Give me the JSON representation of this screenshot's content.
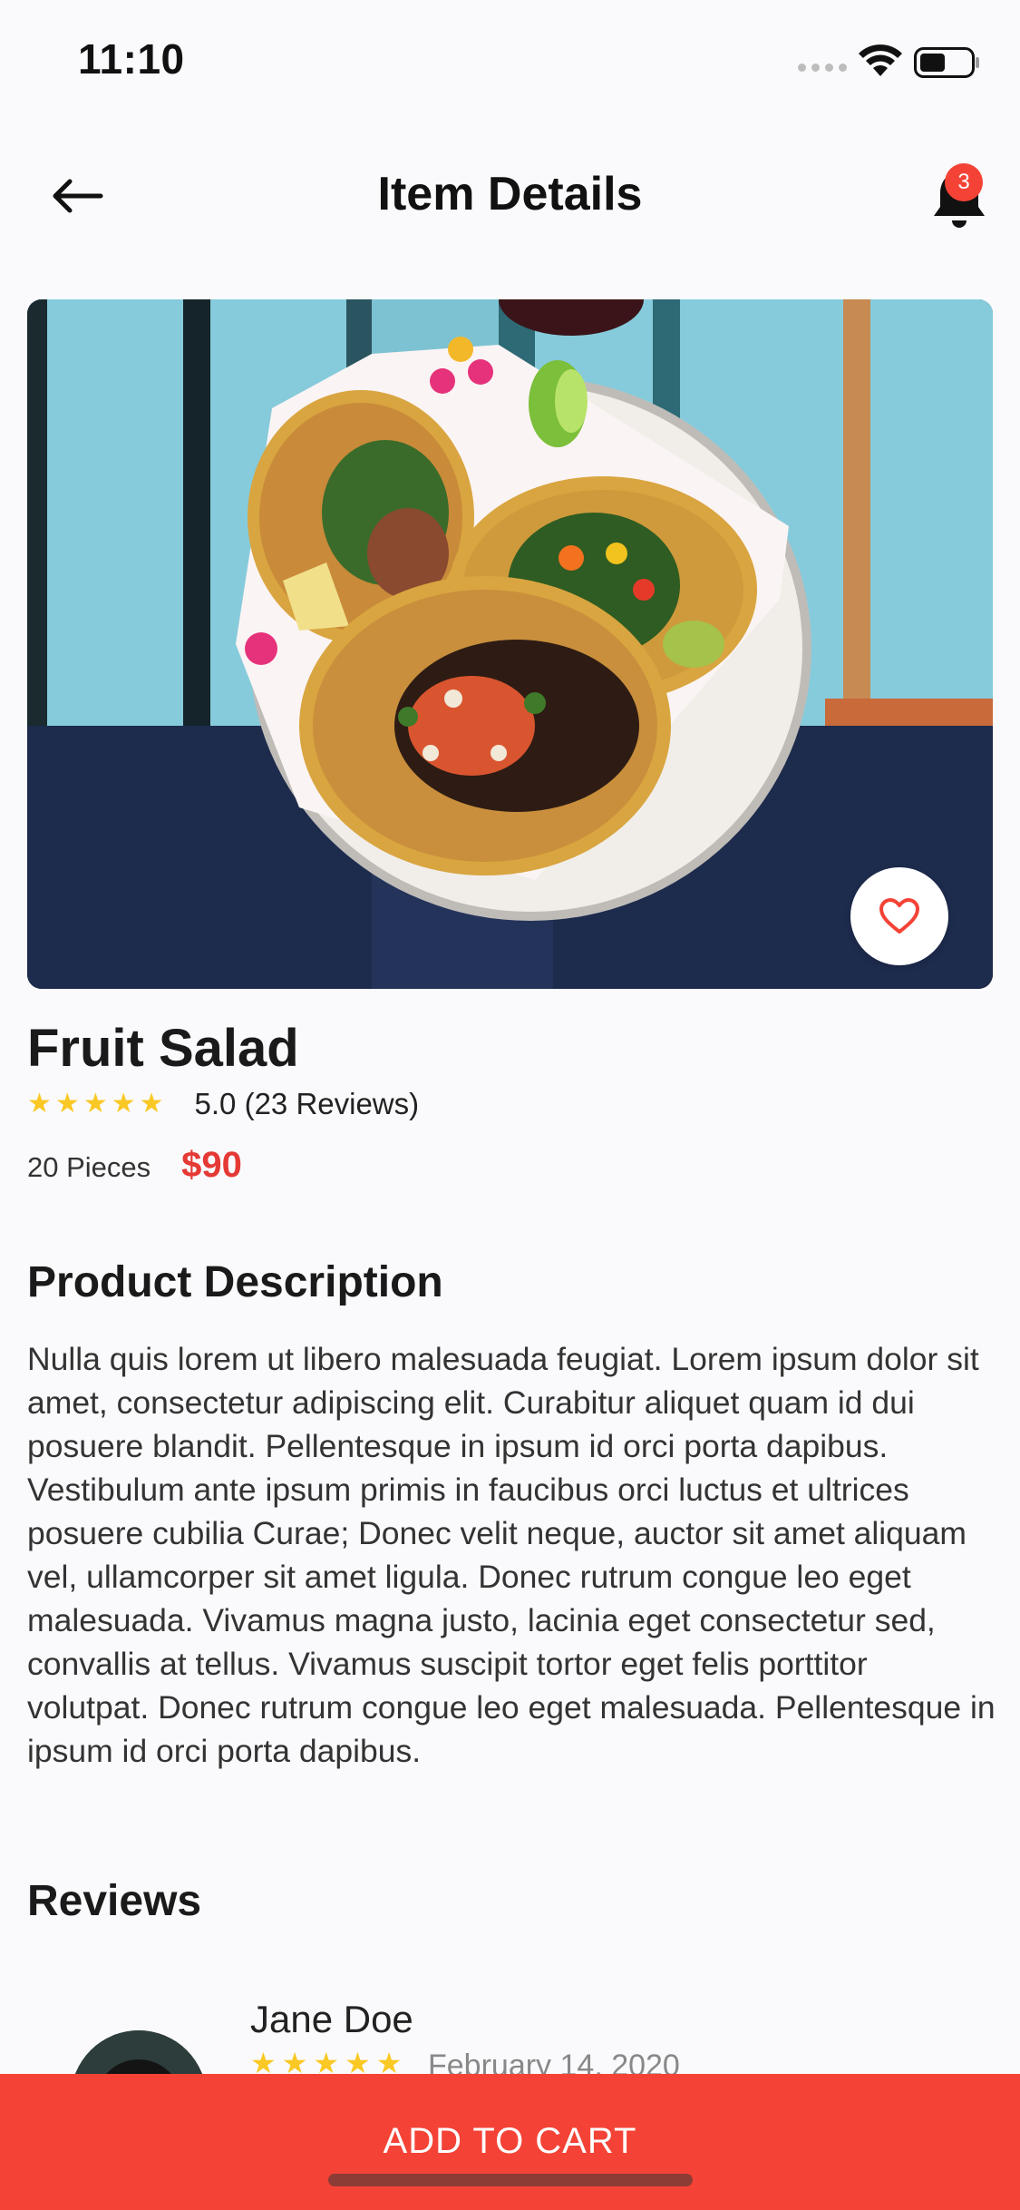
{
  "status_bar": {
    "time": "11:10"
  },
  "header": {
    "title": "Item Details",
    "notification_count": "3"
  },
  "icons": {
    "back": "arrow-left-icon",
    "notifications": "bell-icon",
    "favorite": "heart-outline-icon",
    "rating_star": "star-icon"
  },
  "item": {
    "name": "Fruit Salad",
    "rating": 5,
    "rating_text": "5.0 (23 Reviews)",
    "pieces": "20 Pieces",
    "price": "$90"
  },
  "description": {
    "title": "Product Description",
    "text": "Nulla quis lorem ut libero malesuada feugiat. Lorem ipsum dolor sit amet, consectetur adipiscing elit. Curabitur aliquet quam id dui posuere blandit. Pellentesque in ipsum id orci porta dapibus. Vestibulum ante ipsum primis in faucibus orci luctus et ultrices posuere cubilia Curae; Donec velit neque, auctor sit amet aliquam vel, ullamcorper sit amet ligula. Donec rutrum congue leo eget malesuada. Vivamus magna justo, lacinia eget consectetur sed, convallis at tellus. Vivamus suscipit tortor eget felis porttitor volutpat. Donec rutrum congue leo eget malesuada. Pellentesque in ipsum id orci porta dapibus."
  },
  "reviews": {
    "title": "Reviews",
    "items": [
      {
        "name": "Jane Doe",
        "rating": 5,
        "date": "February 14, 2020"
      }
    ]
  },
  "cart": {
    "label": "ADD TO CART"
  },
  "colors": {
    "accent": "#f44336",
    "price": "#e53935",
    "star": "#f9c824",
    "background": "#fafafc"
  }
}
